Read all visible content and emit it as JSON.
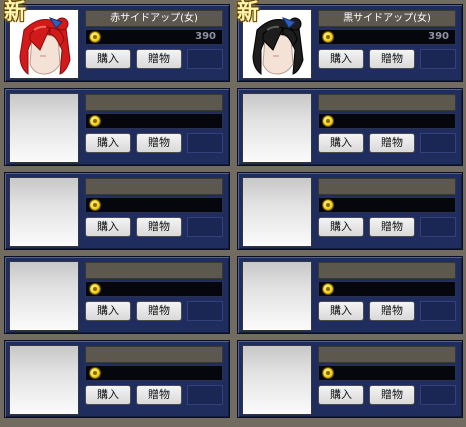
{
  "shop": {
    "items": [
      {
        "name": "赤サイドアップ(女)",
        "price": "390",
        "buy_label": "購入",
        "gift_label": "贈物",
        "is_new": true,
        "new_label": "新",
        "hair": "red"
      },
      {
        "name": "黒サイドアップ(女)",
        "price": "390",
        "buy_label": "購入",
        "gift_label": "贈物",
        "is_new": true,
        "new_label": "新",
        "hair": "black"
      },
      {
        "name": "",
        "price": "",
        "buy_label": "購入",
        "gift_label": "贈物",
        "is_new": false
      },
      {
        "name": "",
        "price": "",
        "buy_label": "購入",
        "gift_label": "贈物",
        "is_new": false
      },
      {
        "name": "",
        "price": "",
        "buy_label": "購入",
        "gift_label": "贈物",
        "is_new": false
      },
      {
        "name": "",
        "price": "",
        "buy_label": "購入",
        "gift_label": "贈物",
        "is_new": false
      },
      {
        "name": "",
        "price": "",
        "buy_label": "購入",
        "gift_label": "贈物",
        "is_new": false
      },
      {
        "name": "",
        "price": "",
        "buy_label": "購入",
        "gift_label": "贈物",
        "is_new": false
      },
      {
        "name": "",
        "price": "",
        "buy_label": "購入",
        "gift_label": "贈物",
        "is_new": false
      },
      {
        "name": "",
        "price": "",
        "buy_label": "購入",
        "gift_label": "贈物",
        "is_new": false
      }
    ]
  },
  "colors": {
    "background": "#716c5f",
    "card": "#1e2c5e",
    "name_bar": "#5c584d",
    "price_bar": "#05070d",
    "red_hair": "#d21a1a",
    "black_hair": "#1d1d1d"
  },
  "icons": {
    "coin": "coin-icon",
    "thumbnail": "hair-avatar-icon"
  }
}
